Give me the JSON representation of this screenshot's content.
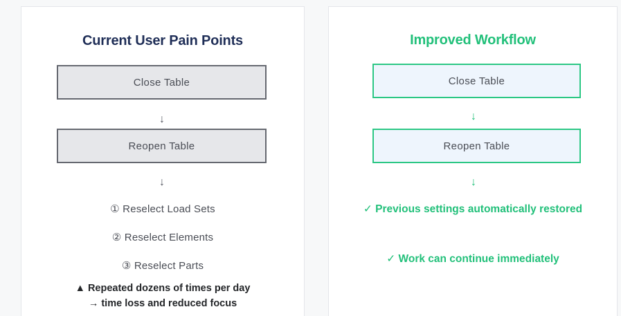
{
  "left_panel": {
    "title": "Current User Pain Points",
    "box_1": "Close Table",
    "box_2": "Reopen Table",
    "arrow": "↓",
    "steps": [
      "① Reselect Load Sets",
      "② Reselect Elements",
      "③ Reselect Parts"
    ],
    "warning_line_1": "▲ Repeated dozens of times per day",
    "warning_line_2": "→ time loss and reduced focus"
  },
  "right_panel": {
    "title": "Improved Workflow",
    "box_1": "Close Table",
    "box_2": "Reopen Table",
    "arrow": "↓",
    "benefits": [
      "✓ Previous settings automatically restored",
      "✓ Work can continue immediately"
    ]
  },
  "colors": {
    "left_title": "#1f2e57",
    "accent_green": "#22c07a",
    "gray_box_fill": "#e6e7ea",
    "gray_box_border": "#656870",
    "green_box_fill": "#eef5fd",
    "green_box_border": "#2bc784"
  }
}
